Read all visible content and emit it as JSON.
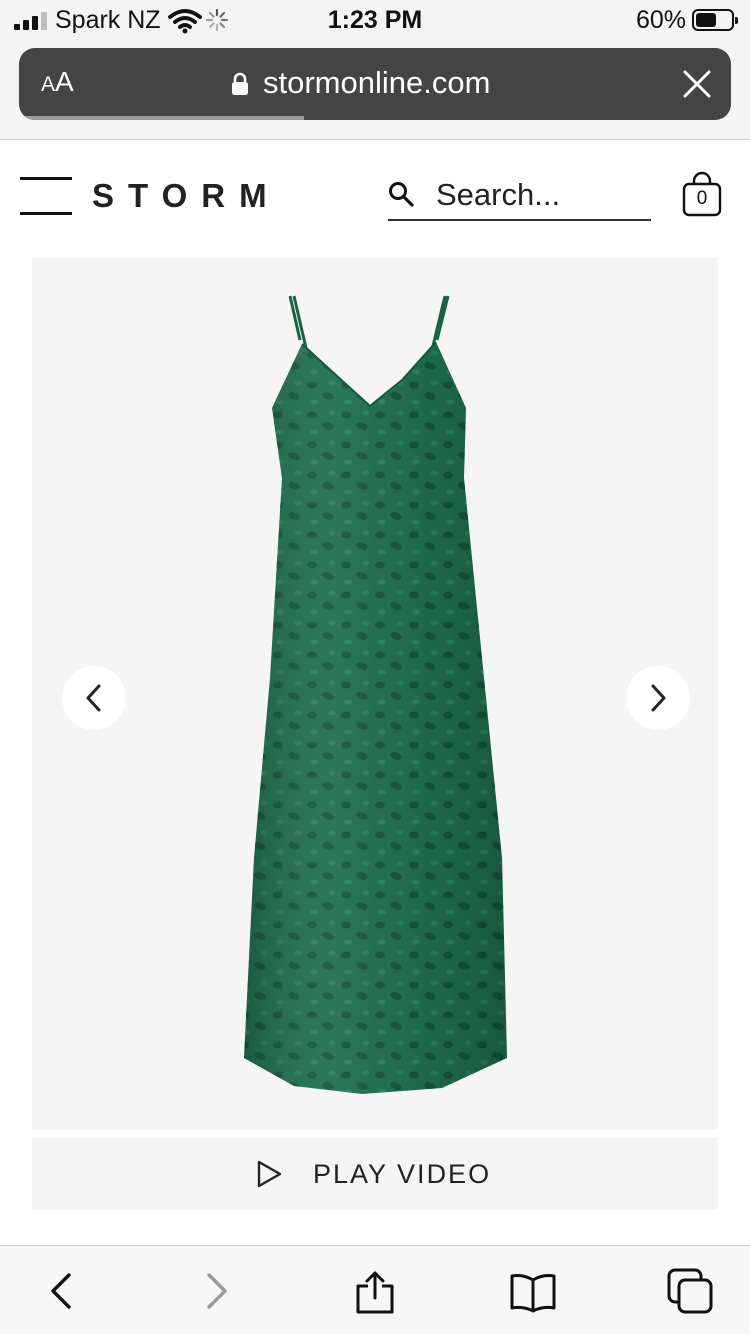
{
  "status_bar": {
    "carrier": "Spark NZ",
    "time": "1:23 PM",
    "battery_percent": "60%",
    "battery_level": 0.6,
    "icons": [
      "signal-icon",
      "wifi-icon",
      "loading-spinner-icon",
      "battery-icon"
    ]
  },
  "browser": {
    "reader_label_small": "A",
    "reader_label_large": "A",
    "url": "stormonline.com",
    "page_load_progress": 0.4,
    "icons": [
      "lock-icon",
      "close-icon"
    ]
  },
  "site_header": {
    "logo": "STORM",
    "search_placeholder": "Search...",
    "cart_count": "0",
    "icons": [
      "menu-icon",
      "search-icon",
      "shopping-bag-icon"
    ]
  },
  "product_gallery": {
    "image_alt": "Green leopard jacquard slip dress",
    "dress_color": "#1e6e4e",
    "icons": [
      "chevron-left-icon",
      "chevron-right-icon"
    ],
    "video_button_label": "PLAY VIDEO"
  },
  "toolbar": {
    "items": [
      "back-icon",
      "forward-icon",
      "share-icon",
      "bookmarks-icon",
      "tabs-icon"
    ]
  }
}
